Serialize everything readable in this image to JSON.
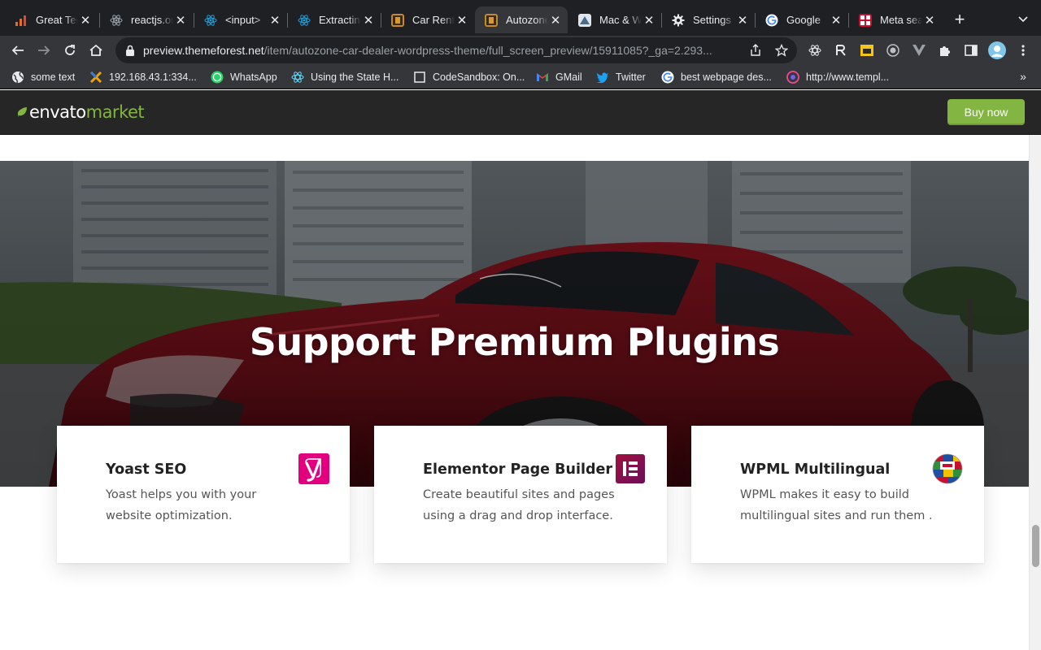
{
  "browser": {
    "tabs": [
      {
        "title": "Great Tech",
        "icon": "chart-favicon"
      },
      {
        "title": "reactjs.org",
        "icon": "react-favicon"
      },
      {
        "title": "<input>",
        "icon": "react-favicon"
      },
      {
        "title": "Extracting",
        "icon": "react-favicon"
      },
      {
        "title": "Car Rental",
        "icon": "autozone-favicon"
      },
      {
        "title": "Autozone",
        "icon": "autozone-favicon",
        "active": true
      },
      {
        "title": "Mac & Windows",
        "icon": "mac-favicon"
      },
      {
        "title": "Settings",
        "icon": "gear-icon"
      },
      {
        "title": "Google",
        "icon": "google-favicon"
      },
      {
        "title": "Meta search",
        "icon": "meta-favicon"
      }
    ],
    "close_glyph": "✕",
    "new_tab_glyph": "+",
    "tab_menu_glyph": "⌄",
    "url_host": "preview.themeforest.net",
    "url_path": "/item/autozone-car-dealer-wordpress-theme/full_screen_preview/15911085?_ga=2.293...",
    "bookmarks": [
      {
        "label": "some text",
        "icon": "globe-icon"
      },
      {
        "label": "192.168.43.1:334...",
        "icon": "x-favicon"
      },
      {
        "label": "WhatsApp",
        "icon": "whatsapp-icon"
      },
      {
        "label": "Using the State H...",
        "icon": "react-favicon"
      },
      {
        "label": "CodeSandbox: On...",
        "icon": "codesandbox-icon"
      },
      {
        "label": "GMail",
        "icon": "gmail-icon"
      },
      {
        "label": "Twitter",
        "icon": "twitter-icon"
      },
      {
        "label": "best webpage des...",
        "icon": "google-favicon"
      },
      {
        "label": "http://www.templ...",
        "icon": "dribbble-icon"
      }
    ],
    "bookmarks_more_glyph": "»"
  },
  "envato": {
    "logo_word1": "envato",
    "logo_word2": "market",
    "buy_label": "Buy now",
    "accent": "#82b541"
  },
  "page": {
    "hero_title": "Support Premium Plugins",
    "cards": [
      {
        "title": "Yoast SEO",
        "desc": "Yoast helps you with your website optimization.",
        "icon": "yoast-icon",
        "icon_color": "#e3007e",
        "icon_glyph": "y"
      },
      {
        "title": "Elementor Page Builder",
        "desc": "Create beautiful sites and pages using a drag and drop interface.",
        "icon": "elementor-icon",
        "icon_color": "#92003b",
        "icon_glyph": "E"
      },
      {
        "title": "WPML Multilingual",
        "desc": "WPML makes it easy to build multilingual sites and run them .",
        "icon": "wpml-flags-icon"
      }
    ]
  }
}
